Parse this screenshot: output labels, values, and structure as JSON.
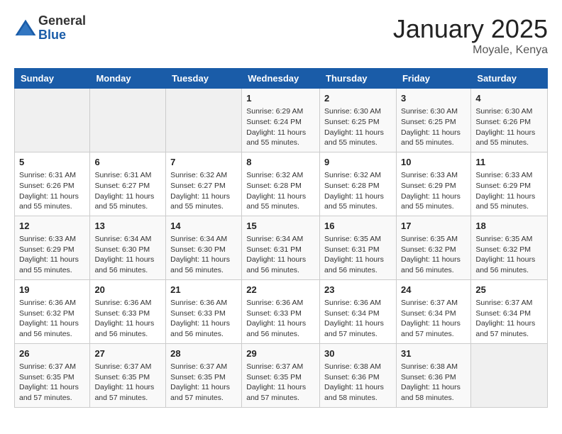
{
  "logo": {
    "general": "General",
    "blue": "Blue"
  },
  "title": "January 2025",
  "location": "Moyale, Kenya",
  "days_header": [
    "Sunday",
    "Monday",
    "Tuesday",
    "Wednesday",
    "Thursday",
    "Friday",
    "Saturday"
  ],
  "weeks": [
    [
      {
        "day": "",
        "info": ""
      },
      {
        "day": "",
        "info": ""
      },
      {
        "day": "",
        "info": ""
      },
      {
        "day": "1",
        "info": "Sunrise: 6:29 AM\nSunset: 6:24 PM\nDaylight: 11 hours\nand 55 minutes."
      },
      {
        "day": "2",
        "info": "Sunrise: 6:30 AM\nSunset: 6:25 PM\nDaylight: 11 hours\nand 55 minutes."
      },
      {
        "day": "3",
        "info": "Sunrise: 6:30 AM\nSunset: 6:25 PM\nDaylight: 11 hours\nand 55 minutes."
      },
      {
        "day": "4",
        "info": "Sunrise: 6:30 AM\nSunset: 6:26 PM\nDaylight: 11 hours\nand 55 minutes."
      }
    ],
    [
      {
        "day": "5",
        "info": "Sunrise: 6:31 AM\nSunset: 6:26 PM\nDaylight: 11 hours\nand 55 minutes."
      },
      {
        "day": "6",
        "info": "Sunrise: 6:31 AM\nSunset: 6:27 PM\nDaylight: 11 hours\nand 55 minutes."
      },
      {
        "day": "7",
        "info": "Sunrise: 6:32 AM\nSunset: 6:27 PM\nDaylight: 11 hours\nand 55 minutes."
      },
      {
        "day": "8",
        "info": "Sunrise: 6:32 AM\nSunset: 6:28 PM\nDaylight: 11 hours\nand 55 minutes."
      },
      {
        "day": "9",
        "info": "Sunrise: 6:32 AM\nSunset: 6:28 PM\nDaylight: 11 hours\nand 55 minutes."
      },
      {
        "day": "10",
        "info": "Sunrise: 6:33 AM\nSunset: 6:29 PM\nDaylight: 11 hours\nand 55 minutes."
      },
      {
        "day": "11",
        "info": "Sunrise: 6:33 AM\nSunset: 6:29 PM\nDaylight: 11 hours\nand 55 minutes."
      }
    ],
    [
      {
        "day": "12",
        "info": "Sunrise: 6:33 AM\nSunset: 6:29 PM\nDaylight: 11 hours\nand 55 minutes."
      },
      {
        "day": "13",
        "info": "Sunrise: 6:34 AM\nSunset: 6:30 PM\nDaylight: 11 hours\nand 56 minutes."
      },
      {
        "day": "14",
        "info": "Sunrise: 6:34 AM\nSunset: 6:30 PM\nDaylight: 11 hours\nand 56 minutes."
      },
      {
        "day": "15",
        "info": "Sunrise: 6:34 AM\nSunset: 6:31 PM\nDaylight: 11 hours\nand 56 minutes."
      },
      {
        "day": "16",
        "info": "Sunrise: 6:35 AM\nSunset: 6:31 PM\nDaylight: 11 hours\nand 56 minutes."
      },
      {
        "day": "17",
        "info": "Sunrise: 6:35 AM\nSunset: 6:32 PM\nDaylight: 11 hours\nand 56 minutes."
      },
      {
        "day": "18",
        "info": "Sunrise: 6:35 AM\nSunset: 6:32 PM\nDaylight: 11 hours\nand 56 minutes."
      }
    ],
    [
      {
        "day": "19",
        "info": "Sunrise: 6:36 AM\nSunset: 6:32 PM\nDaylight: 11 hours\nand 56 minutes."
      },
      {
        "day": "20",
        "info": "Sunrise: 6:36 AM\nSunset: 6:33 PM\nDaylight: 11 hours\nand 56 minutes."
      },
      {
        "day": "21",
        "info": "Sunrise: 6:36 AM\nSunset: 6:33 PM\nDaylight: 11 hours\nand 56 minutes."
      },
      {
        "day": "22",
        "info": "Sunrise: 6:36 AM\nSunset: 6:33 PM\nDaylight: 11 hours\nand 56 minutes."
      },
      {
        "day": "23",
        "info": "Sunrise: 6:36 AM\nSunset: 6:34 PM\nDaylight: 11 hours\nand 57 minutes."
      },
      {
        "day": "24",
        "info": "Sunrise: 6:37 AM\nSunset: 6:34 PM\nDaylight: 11 hours\nand 57 minutes."
      },
      {
        "day": "25",
        "info": "Sunrise: 6:37 AM\nSunset: 6:34 PM\nDaylight: 11 hours\nand 57 minutes."
      }
    ],
    [
      {
        "day": "26",
        "info": "Sunrise: 6:37 AM\nSunset: 6:35 PM\nDaylight: 11 hours\nand 57 minutes."
      },
      {
        "day": "27",
        "info": "Sunrise: 6:37 AM\nSunset: 6:35 PM\nDaylight: 11 hours\nand 57 minutes."
      },
      {
        "day": "28",
        "info": "Sunrise: 6:37 AM\nSunset: 6:35 PM\nDaylight: 11 hours\nand 57 minutes."
      },
      {
        "day": "29",
        "info": "Sunrise: 6:37 AM\nSunset: 6:35 PM\nDaylight: 11 hours\nand 57 minutes."
      },
      {
        "day": "30",
        "info": "Sunrise: 6:38 AM\nSunset: 6:36 PM\nDaylight: 11 hours\nand 58 minutes."
      },
      {
        "day": "31",
        "info": "Sunrise: 6:38 AM\nSunset: 6:36 PM\nDaylight: 11 hours\nand 58 minutes."
      },
      {
        "day": "",
        "info": ""
      }
    ]
  ]
}
